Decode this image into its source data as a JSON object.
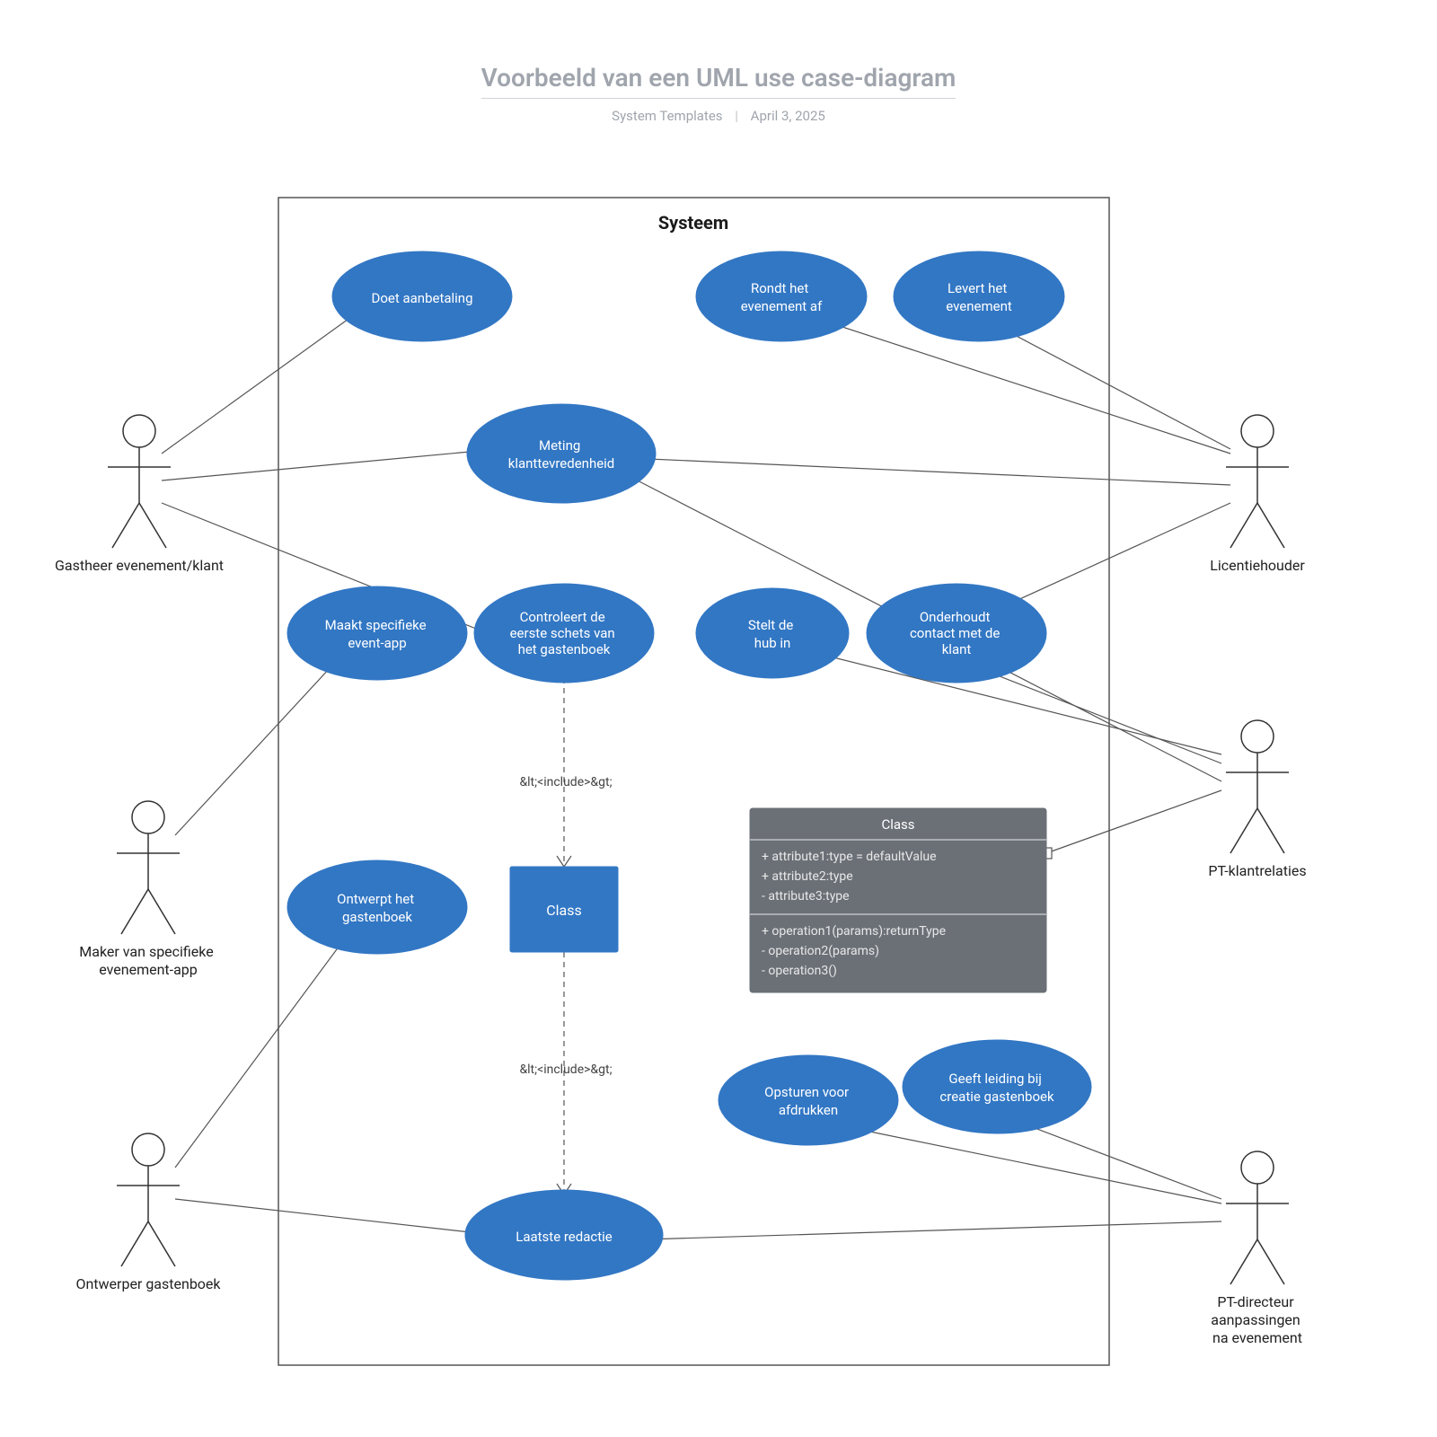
{
  "header": {
    "title": "Voorbeeld van een UML use case-diagram",
    "author": "System Templates",
    "date": "April 3, 2025"
  },
  "system": {
    "title": "Systeem"
  },
  "usecases": {
    "doet_aanbetaling": "Doet aanbetaling",
    "rondt_af": "Rondt het evenement af",
    "levert": "Levert het evenement",
    "meting": "Meting klanttevredenheid",
    "maakt_app": "Maakt specifieke event-app",
    "controleert": "Controleert de eerste schets van het gastenboek",
    "stelt_hub": "Stelt de hub in",
    "onderhoudt": "Onderhoudt contact met de klant",
    "ontwerpt": "Ontwerpt het gastenboek",
    "class_block": "Class",
    "opsturen": "Opsturen voor afdrukken",
    "leiding": "Geeft leiding bij creatie gastenboek",
    "redactie": "Laatste redactie"
  },
  "actors": {
    "gastheer": "Gastheer evenement/klant",
    "maker": "Maker van specifieke evenement-app",
    "ontwerper": "Ontwerper gastenboek",
    "licentie": "Licentiehouder",
    "pt_klant": "PT-klantrelaties",
    "pt_dir": "PT-directeur aanpassingen na evenement"
  },
  "include_label": "&lt;<include>&gt;",
  "classbox": {
    "title": "Class",
    "attrs": [
      "+ attribute1:type = defaultValue",
      "+ attribute2:type",
      "- attribute3:type"
    ],
    "ops": [
      "+ operation1(params):returnType",
      "- operation2(params)",
      "- operation3()"
    ]
  }
}
